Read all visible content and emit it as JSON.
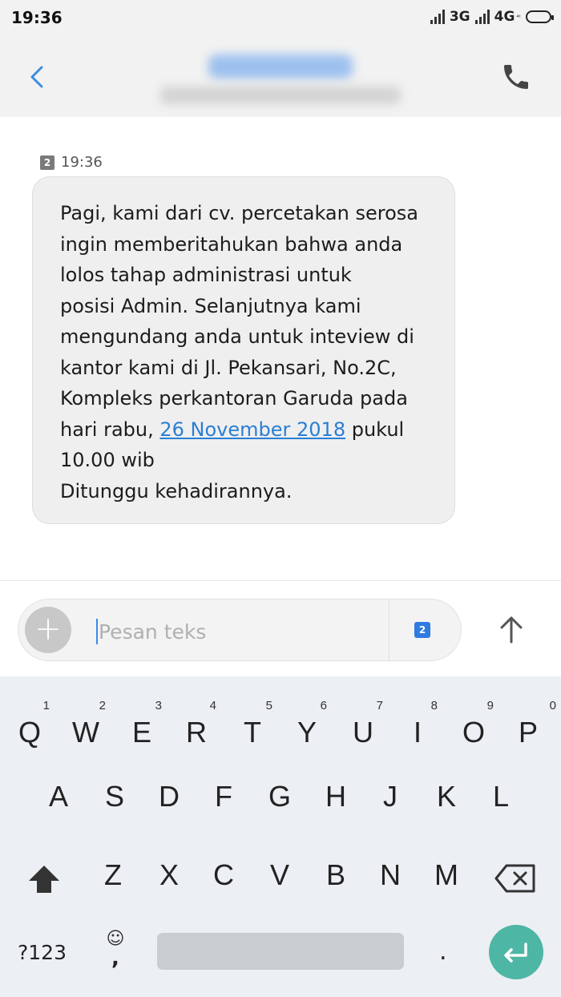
{
  "status_bar": {
    "time": "19:36",
    "network1": "3G",
    "network2": "4G",
    "network2_sup": "⁴ᵗ"
  },
  "header": {
    "contact_name": "[blurred]",
    "contact_number": "[blurred]"
  },
  "message": {
    "sim": "2",
    "time": "19:36",
    "lines": [
      "Pagi, kami dari cv. percetakan serosa",
      "ingin memberitahukan bahwa anda",
      "lolos tahap administrasi untuk",
      "posisi Admin. Selanjutnya kami",
      "mengundang anda untuk inteview di",
      "kantor kami di Jl. Pekansari, No.2C,",
      "Kompleks perkantoran Garuda pada"
    ],
    "line8_before": "hari rabu, ",
    "line8_link": "26 November 2018",
    "line8_after": " pukul",
    "line9": "10.00 wib",
    "line10": "Ditunggu kehadirannya."
  },
  "compose": {
    "placeholder": "Pesan teks",
    "plus": "+",
    "sim": "2"
  },
  "keyboard": {
    "row1": [
      {
        "key": "Q",
        "hint": "1"
      },
      {
        "key": "W",
        "hint": "2"
      },
      {
        "key": "E",
        "hint": "3"
      },
      {
        "key": "R",
        "hint": "4"
      },
      {
        "key": "T",
        "hint": "5"
      },
      {
        "key": "Y",
        "hint": "6"
      },
      {
        "key": "U",
        "hint": "7"
      },
      {
        "key": "I",
        "hint": "8"
      },
      {
        "key": "O",
        "hint": "9"
      },
      {
        "key": "P",
        "hint": "0"
      }
    ],
    "row2": [
      "A",
      "S",
      "D",
      "F",
      "G",
      "H",
      "J",
      "K",
      "L"
    ],
    "row3": [
      "Z",
      "X",
      "C",
      "V",
      "B",
      "N",
      "M"
    ],
    "num_key": "?123",
    "emoji": "☺",
    "comma": ",",
    "period": "."
  },
  "colors": {
    "accent_blue": "#2a7fd4",
    "enter_teal": "#4db6a4",
    "back_arrow": "#3b8de0"
  }
}
